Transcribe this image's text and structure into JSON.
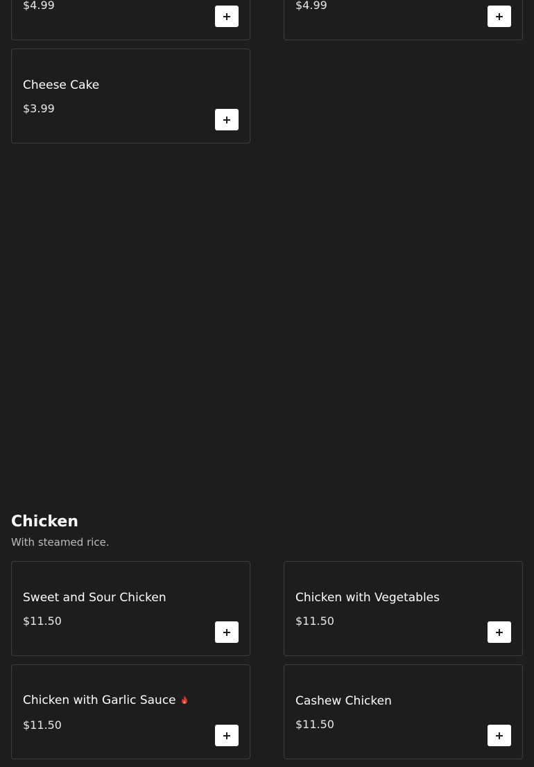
{
  "top_items": [
    {
      "price": "$4.99"
    },
    {
      "price": "$4.99"
    }
  ],
  "dessert_items": [
    {
      "name": "Cheese Cake",
      "price": "$3.99"
    }
  ],
  "chicken_section": {
    "title": "Chicken",
    "description": "With steamed rice.",
    "items": [
      {
        "name": "Sweet and Sour Chicken",
        "price": "$11.50"
      },
      {
        "name": "Chicken with Vegetables",
        "price": "$11.50"
      },
      {
        "name": "Chicken with Garlic Sauce",
        "price": "$11.50",
        "icon": "spicy-flame-icon"
      },
      {
        "name": "Cashew Chicken",
        "price": "$11.50"
      }
    ]
  },
  "colors": {
    "background": "#1d1d1d",
    "card_border": "#3e3e3e",
    "button_bg": "#ffffff",
    "spicy_icon": "#d9342b"
  }
}
